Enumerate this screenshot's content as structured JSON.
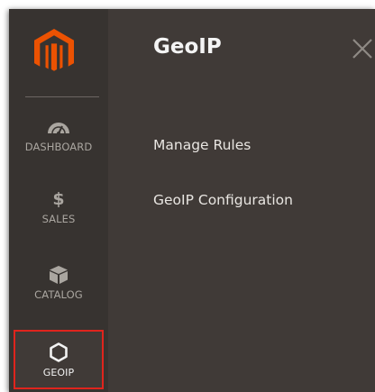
{
  "sidebar": {
    "items": [
      {
        "label": "DASHBOARD",
        "icon": "speedometer-icon"
      },
      {
        "label": "SALES",
        "icon": "dollar-icon"
      },
      {
        "label": "CATALOG",
        "icon": "box-icon"
      },
      {
        "label": "GEOIP",
        "icon": "hexagon-icon"
      }
    ]
  },
  "panel": {
    "title": "GeoIP",
    "links": [
      "Manage Rules",
      "GeoIP Configuration"
    ]
  },
  "colors": {
    "logo_orange": "#eb5202",
    "highlight_red": "#e0241d",
    "sidebar_bg": "#373330",
    "panel_bg": "#403a37"
  }
}
